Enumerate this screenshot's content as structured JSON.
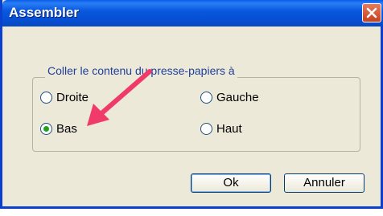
{
  "window": {
    "title": "Assembler",
    "close_icon": "close-icon"
  },
  "group": {
    "legend": "Coller le contenu du presse-papiers à"
  },
  "options": [
    {
      "label": "Droite",
      "selected": false
    },
    {
      "label": "Gauche",
      "selected": false
    },
    {
      "label": "Bas",
      "selected": true
    },
    {
      "label": "Haut",
      "selected": false
    }
  ],
  "buttons": {
    "ok": "Ok",
    "cancel": "Annuler"
  },
  "colors": {
    "titlebar": "#0a5ae8",
    "dialog_bg": "#ece9d8",
    "legend_text": "#1f3f9a",
    "annotation_arrow": "#f03a6a"
  }
}
